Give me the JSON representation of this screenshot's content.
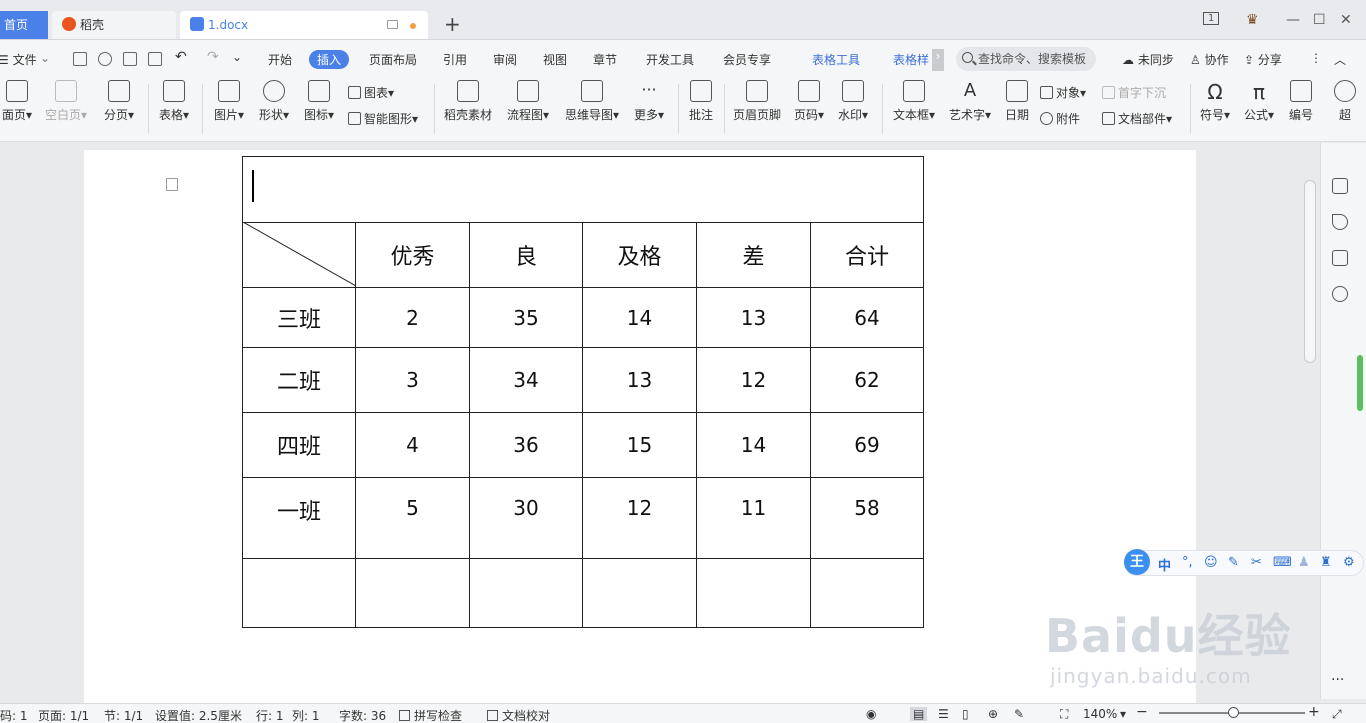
{
  "tabs": {
    "home": "首页",
    "daoke": "稻壳",
    "doc": "1.docx",
    "add": "+"
  },
  "window": {
    "badge": "1",
    "minimize": "—",
    "maximize": "☐",
    "close": "✕"
  },
  "menubar": {
    "file": "☰ 文件",
    "items": [
      "开始",
      "插入",
      "页面布局",
      "引用",
      "审阅",
      "视图",
      "章节",
      "开发工具",
      "会员专享"
    ],
    "active": "插入",
    "table_tools": "表格工具",
    "table_style": "表格样",
    "search_placeholder": "查找命令、搜索模板",
    "unsync": "未同步",
    "collab": "协作",
    "share": "分享"
  },
  "ribbon": {
    "cover_page": "面页",
    "blank_page": "空白页",
    "page_break": "分页",
    "table": "表格",
    "picture": "图片",
    "shape": "形状",
    "icon": "图标",
    "chart": "图表",
    "smart_art": "智能图形",
    "daoke_material": "稻壳素材",
    "flowchart": "流程图",
    "mindmap": "思维导图",
    "more": "更多",
    "comment": "批注",
    "header_footer": "页眉页脚",
    "page_number": "页码",
    "watermark": "水印",
    "textbox": "文本框",
    "wordart": "艺术字",
    "date": "日期",
    "object": "对象",
    "attachment": "附件",
    "dropcap": "首字下沉",
    "doc_parts": "文档部件",
    "symbol": "符号",
    "formula": "公式",
    "numbering": "编号",
    "hyperlink": "超"
  },
  "table": {
    "headers": [
      "优秀",
      "良",
      "及格",
      "差",
      "合计"
    ],
    "rows": [
      {
        "name": "三班",
        "values": [
          "2",
          "35",
          "14",
          "13",
          "64"
        ]
      },
      {
        "name": "二班",
        "values": [
          "3",
          "34",
          "13",
          "12",
          "62"
        ]
      },
      {
        "name": "四班",
        "values": [
          "4",
          "36",
          "15",
          "14",
          "69"
        ]
      },
      {
        "name": "一班",
        "values": [
          "5",
          "30",
          "12",
          "11",
          "58"
        ]
      }
    ]
  },
  "ime": {
    "logo": "王",
    "mode": "中",
    "punct": "°,"
  },
  "watermark": {
    "line1": "Baidu经验",
    "line2": "jingyan.baidu.com"
  },
  "status": {
    "section_num": "码: 1",
    "page": "页面: 1/1",
    "section": "节: 1/1",
    "setting": "设置值: 2.5厘米",
    "row": "行: 1",
    "col": "列: 1",
    "wordcount": "字数: 36",
    "spellcheck": "拼写检查",
    "proofread": "文档校对",
    "zoom": "140%",
    "zoom_minus": "−",
    "zoom_plus": "+"
  }
}
